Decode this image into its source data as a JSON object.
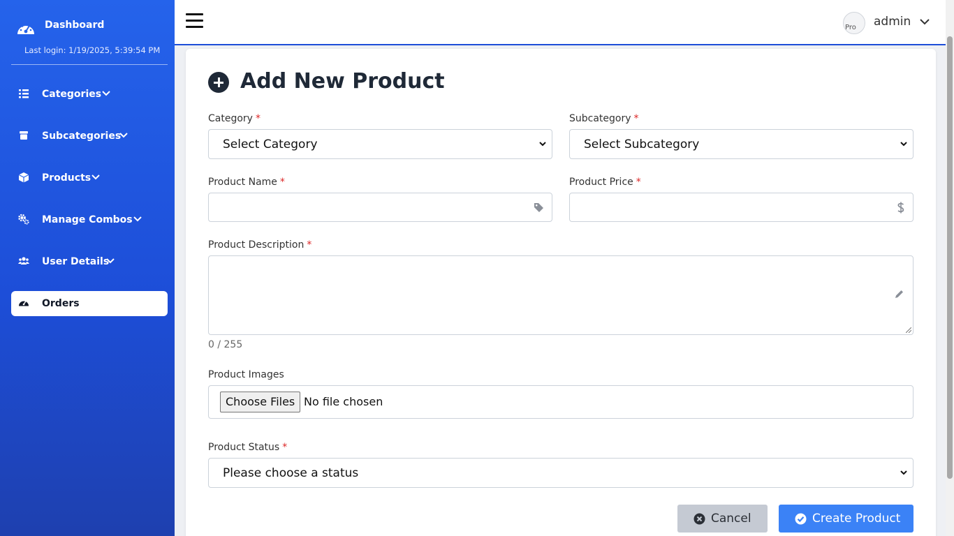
{
  "sidebar": {
    "title": "Dashboard",
    "last_login": "Last login: 1/19/2025, 5:39:54 PM",
    "items": [
      {
        "label": "Categories",
        "icon": "list-icon"
      },
      {
        "label": "Subcategories",
        "icon": "box-icon"
      },
      {
        "label": "Products",
        "icon": "cube-icon"
      },
      {
        "label": "Manage Combos",
        "icon": "gears-icon"
      },
      {
        "label": "User Details",
        "icon": "users-icon"
      },
      {
        "label": "Orders",
        "icon": "gauge-icon",
        "active": true
      }
    ]
  },
  "topbar": {
    "avatar_alt": "Pro",
    "username": "admin"
  },
  "form": {
    "title": "Add New Product",
    "required_mark": "*",
    "category": {
      "label": "Category",
      "value": "Select Category"
    },
    "subcategory": {
      "label": "Subcategory",
      "value": "Select Subcategory"
    },
    "product_name": {
      "label": "Product Name",
      "value": ""
    },
    "product_price": {
      "label": "Product Price",
      "value": ""
    },
    "description": {
      "label": "Product Description",
      "value": "",
      "counter": "0 / 255"
    },
    "images": {
      "label": "Product Images",
      "button": "Choose Files",
      "status": "No file chosen"
    },
    "status": {
      "label": "Product Status",
      "value": "Please choose a status"
    },
    "cancel_label": "Cancel",
    "create_label": "Create Product"
  },
  "colors": {
    "sidebar_top": "#2563eb",
    "sidebar_bottom": "#1e40af",
    "primary": "#3b82f6",
    "required": "#dc2626",
    "cancel_bg": "#c5cad3"
  }
}
